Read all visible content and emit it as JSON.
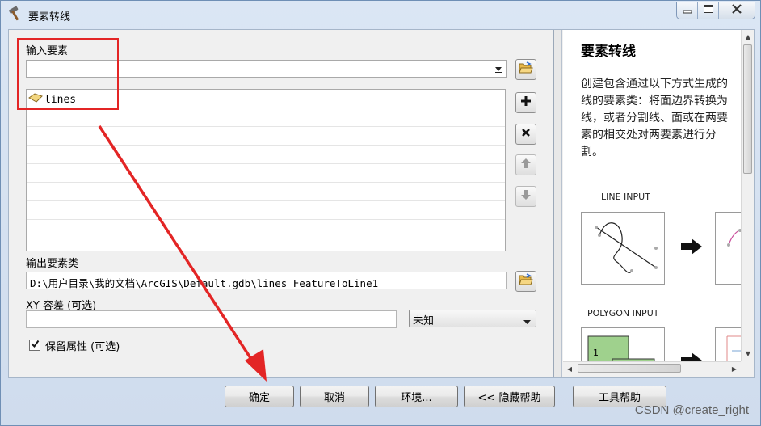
{
  "window": {
    "title": "要素转线"
  },
  "icons": {
    "title": "hammer-icon",
    "minimize": "minimize-icon",
    "maximize": "maximize-icon",
    "close": "close-icon",
    "browse": "open-folder-icon",
    "add": "plus-icon",
    "remove": "x-icon",
    "up": "arrow-up-icon",
    "down": "arrow-down-icon",
    "layer": "polygon-layer-icon"
  },
  "form": {
    "input_features_label": "输入要素",
    "input_features_value": "",
    "input_items": [
      {
        "label": "lines"
      }
    ],
    "output_label": "输出要素类",
    "output_value": "D:\\用户目录\\我的文档\\ArcGIS\\Default.gdb\\lines_FeatureToLine1",
    "xy_label": "XY 容差 (可选)",
    "xy_value": "",
    "xy_unit": "未知",
    "preserve_label": "保留属性 (可选)",
    "preserve_checked": true
  },
  "help": {
    "title": "要素转线",
    "description": "创建包含通过以下方式生成的线的要素类：将面边界转换为线，或者分割线、面或在两要素的相交处对两要素进行分割。",
    "line_input": "LINE INPUT",
    "polygon_input": "POLYGON INPUT",
    "polygon_label": "1"
  },
  "buttons": {
    "ok": "确定",
    "cancel": "取消",
    "env": "环境...",
    "hide_help": "<< 隐藏帮助",
    "tool_help": "工具帮助"
  },
  "watermark": "CSDN @create_right",
  "colors": {
    "annotation_red": "#e32525",
    "window_frame": "#dbe6f4",
    "panel_bg": "#f0f0f0"
  }
}
